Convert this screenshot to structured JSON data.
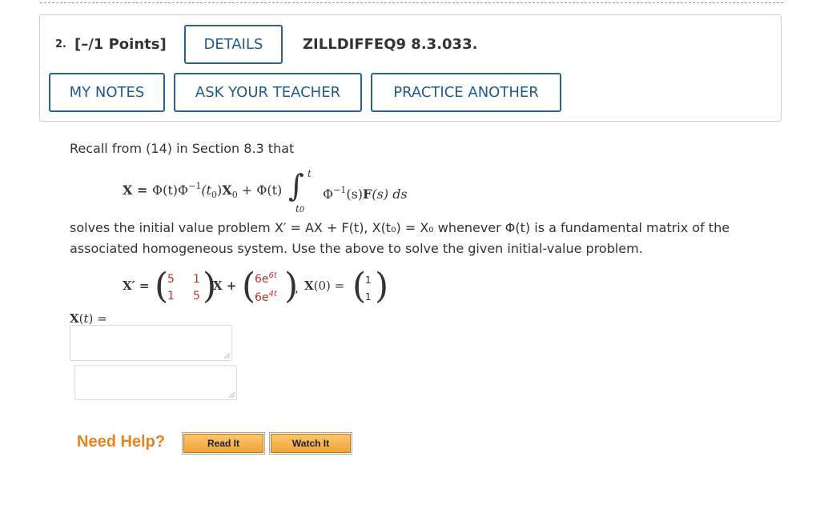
{
  "question": {
    "number": "2.",
    "points": "[–/1 Points]",
    "details_label": "DETAILS",
    "problem_id": "ZILLDIFFEQ9 8.3.033.",
    "my_notes_label": "MY NOTES",
    "ask_teacher_label": "ASK YOUR TEACHER",
    "practice_label": "PRACTICE ANOTHER"
  },
  "body": {
    "recall_text": "Recall from (14) in Section 8.3 that",
    "formula": {
      "x_eq": "X = ",
      "phi_t": "Φ(t)",
      "phi_inv": "Φ",
      "inv_exp": "−1",
      "t0_paren": "(t",
      "t0_sub": "0",
      "t0_close": ")",
      "x0": "X",
      "x0_sub": "0",
      "plus": " + ",
      "phi_t2": "Φ(t)",
      "int_sign": "∫",
      "int_upper": "t",
      "int_lower": "t",
      "int_lower_sub": "0",
      "integrand_phi": "Φ",
      "integrand_exp": "−1",
      "integrand_s": "(s)",
      "integrand_F": "F",
      "integrand_rest": "(s) ds"
    },
    "solves_line1": "solves the initial value problem X′ = AX + F(t), X(t₀) = X₀ whenever Φ(t) is a fundamental matrix of the",
    "solves_line2": "associated homogeneous system. Use the above to solve the given initial-value problem.",
    "system": {
      "xprime": "X′ =",
      "A": [
        "5",
        "1",
        "1",
        "5"
      ],
      "x_plus": "X +",
      "F_top": "6e",
      "F_top_exp": "6t",
      "F_bot": "6e",
      "F_bot_exp": "4t",
      "comma": ",",
      "x0_label": "X(0) =",
      "x0_vec": [
        "1",
        "1"
      ]
    },
    "answer_label": "X(t) ="
  },
  "help": {
    "label": "Need Help?",
    "read_it": "Read It",
    "watch_it": "Watch It"
  },
  "colors": {
    "button_border": "#2a6496",
    "button_text": "#1f5a8b",
    "matrix_red": "#c0312b",
    "help_orange": "#e8821c"
  }
}
